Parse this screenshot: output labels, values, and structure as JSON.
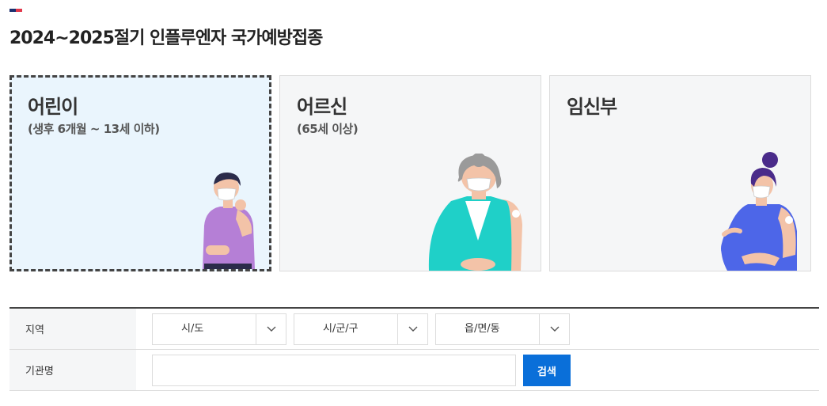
{
  "page": {
    "title": "2024~2025절기 인플루엔자 국가예방접종"
  },
  "cards": [
    {
      "title": "어린이",
      "subtitle": "(생후 6개월 ~ 13세 이하)",
      "selected": true,
      "illustration": "child-vaccinated-illustration"
    },
    {
      "title": "어르신",
      "subtitle": "(65세 이상)",
      "selected": false,
      "illustration": "elderly-vaccinated-illustration"
    },
    {
      "title": "임신부",
      "subtitle": "",
      "selected": false,
      "illustration": "pregnant-woman-vaccinated-illustration"
    }
  ],
  "search_form": {
    "region_label": "지역",
    "region_selects": [
      {
        "value": "시/도"
      },
      {
        "value": "시/군/구"
      },
      {
        "value": "읍/면/동"
      }
    ],
    "institution_label": "기관명",
    "institution_value": "",
    "search_button": "검색"
  },
  "colors": {
    "accent_navy": "#1b2f6e",
    "accent_red": "#e2384b",
    "primary_button": "#0a6fd9",
    "selected_card_bg": "#eaf5fd",
    "card_bg": "#f5f6f7"
  }
}
